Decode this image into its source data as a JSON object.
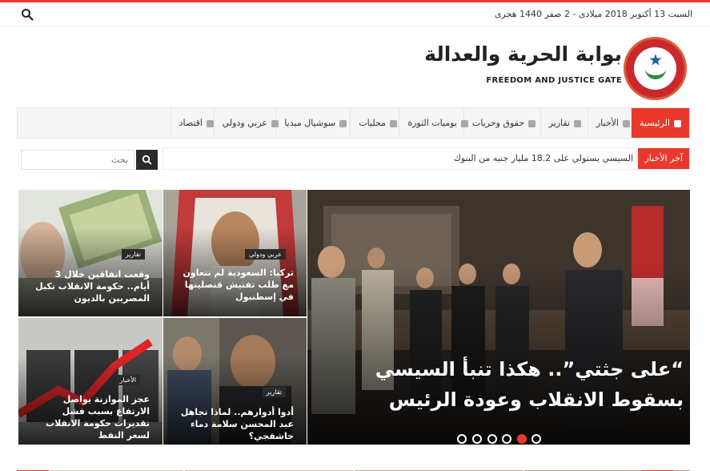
{
  "topbar": {
    "date": "السبت 13 أكتوبر 2018 ميلادى - 2 صفر 1440 هجرى",
    "search_icon": "search-icon"
  },
  "brand": {
    "title_ar": "بوابة الحرية والعدالة",
    "subtitle_en": "FREEDOM AND JUSTICE GATE",
    "colors": {
      "accent": "#e8392c",
      "logo_red": "#c9292d",
      "logo_green": "#2e8b3d",
      "logo_blue": "#1e5ea8"
    }
  },
  "nav": {
    "items": [
      {
        "label": "الرئيسية",
        "icon": "home-icon",
        "active": true
      },
      {
        "label": "الأخبار",
        "icon": "bolt-icon"
      },
      {
        "label": "تقارير",
        "icon": "document-icon"
      },
      {
        "label": "حقوق وحريات",
        "icon": "gavel-icon"
      },
      {
        "label": "يوميات الثورة",
        "icon": "users-icon"
      },
      {
        "label": "محليات",
        "icon": "building-icon"
      },
      {
        "label": "سوشيال ميديا",
        "icon": "comments-icon"
      },
      {
        "label": "عربي ودولي",
        "icon": "globe-icon"
      },
      {
        "label": "اقتصاد",
        "icon": "chart-icon"
      }
    ]
  },
  "ticker": {
    "label": "آخر الأخبار",
    "text": "السيسي يستولي على 18.2 مليار جنيه من البنوك"
  },
  "search": {
    "placeholder": "بحث",
    "button_icon": "search-icon"
  },
  "hero": {
    "title": "“على جثتي”.. هكذا تنبأ السيسي بسقوط الانقلاب وعودة الرئيس",
    "slides_count": 6,
    "active_slide": 2
  },
  "tiles": [
    {
      "category": "عربي ودولي",
      "title": "تركيا: السعودية لم تتعاون مع طلب تفتيش قنصليتها في إسطنبول"
    },
    {
      "category": "تقارير",
      "title": "وقعت اتفاقين خلال 3 أيام.. حكومة الانقلاب تكبل المصريين بالديون"
    },
    {
      "category": "تقارير",
      "title": "أدوا أدوارهم.. لماذا تجاهل عبد المحسن سلامة دماء خاشقجي؟"
    },
    {
      "category": "الأخبار",
      "title": "عجز الموازنة يواصل الارتفاع بسبب فشل تقديرات حكومة الانقلاب لسعر النفط"
    }
  ]
}
